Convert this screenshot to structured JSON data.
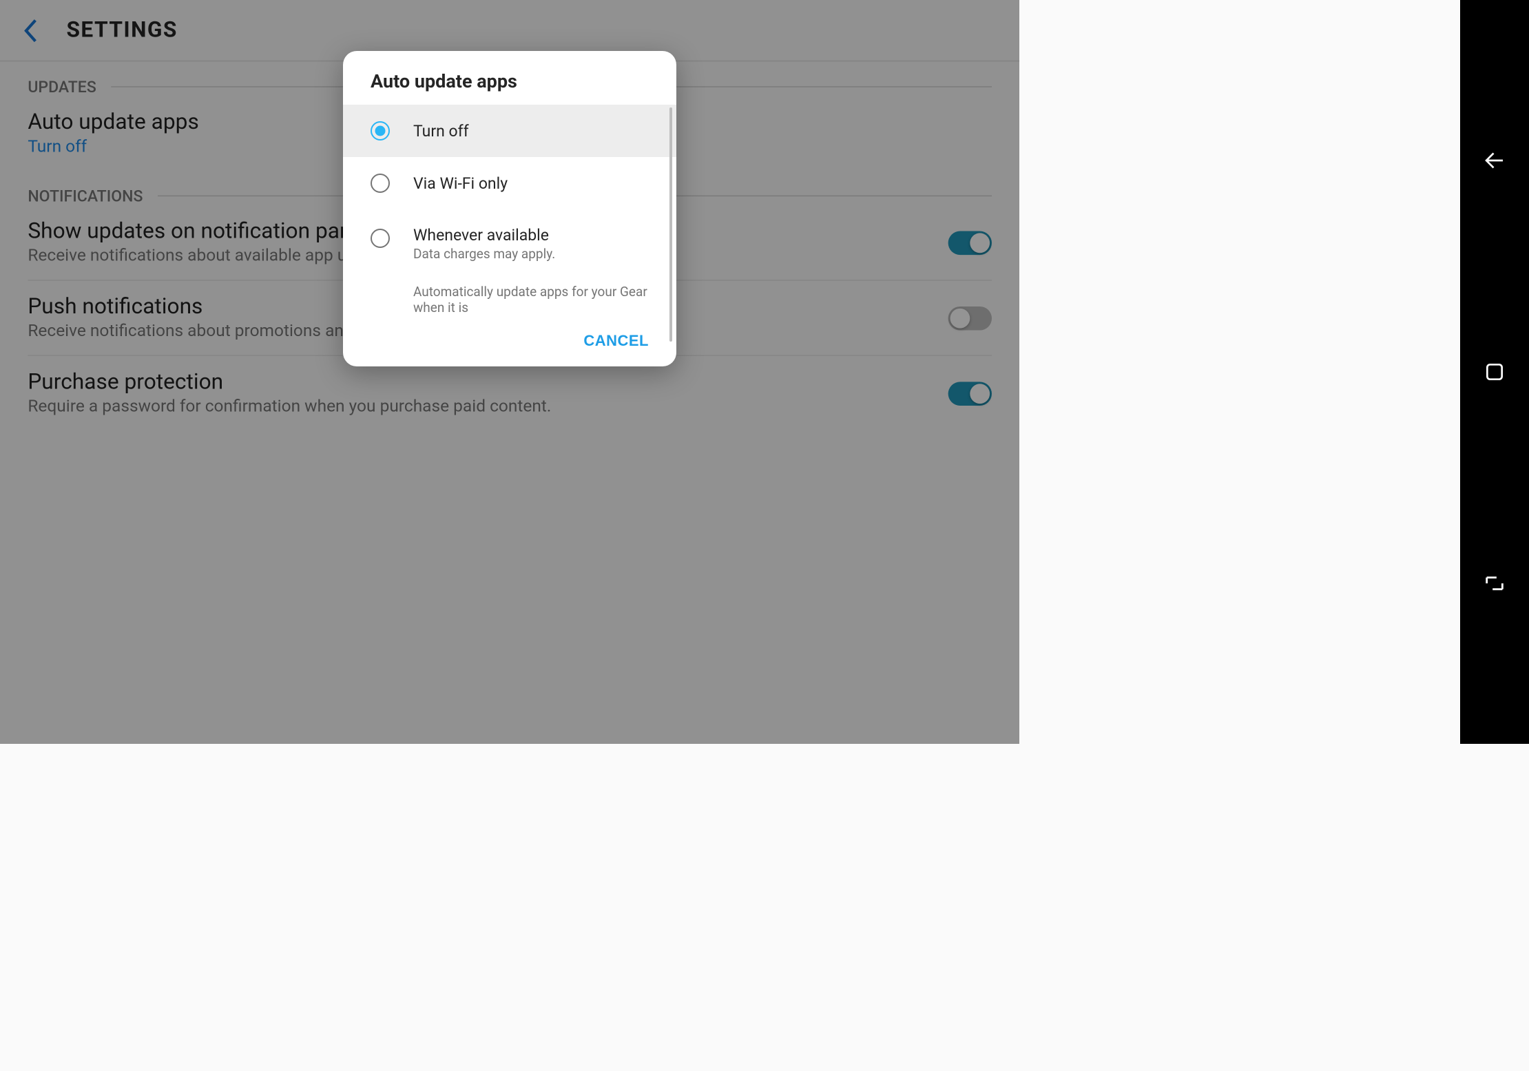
{
  "header": {
    "title": "SETTINGS"
  },
  "sections": {
    "updates": {
      "title": "UPDATES",
      "autoUpdate": {
        "title": "Auto update apps",
        "value": "Turn off"
      }
    },
    "notifications": {
      "title": "NOTIFICATIONS",
      "showUpdates": {
        "title": "Show updates on notification panel",
        "subtitle": "Receive notifications about available app updates.",
        "toggle": true
      },
      "push": {
        "title": "Push notifications",
        "subtitle": "Receive notifications about promotions and events.",
        "toggle": false
      },
      "purchase": {
        "title": "Purchase protection",
        "subtitle": "Require a password for confirmation when you purchase paid content.",
        "toggle": true
      }
    }
  },
  "dialog": {
    "title": "Auto update apps",
    "options": [
      {
        "label": "Turn off",
        "sub": "",
        "selected": true
      },
      {
        "label": "Via Wi-Fi only",
        "sub": "",
        "selected": false
      },
      {
        "label": "Whenever available",
        "sub": "Data charges may apply.",
        "selected": false
      }
    ],
    "extraText": "Automatically update apps for your Gear when it is",
    "cancel": "CANCEL"
  }
}
